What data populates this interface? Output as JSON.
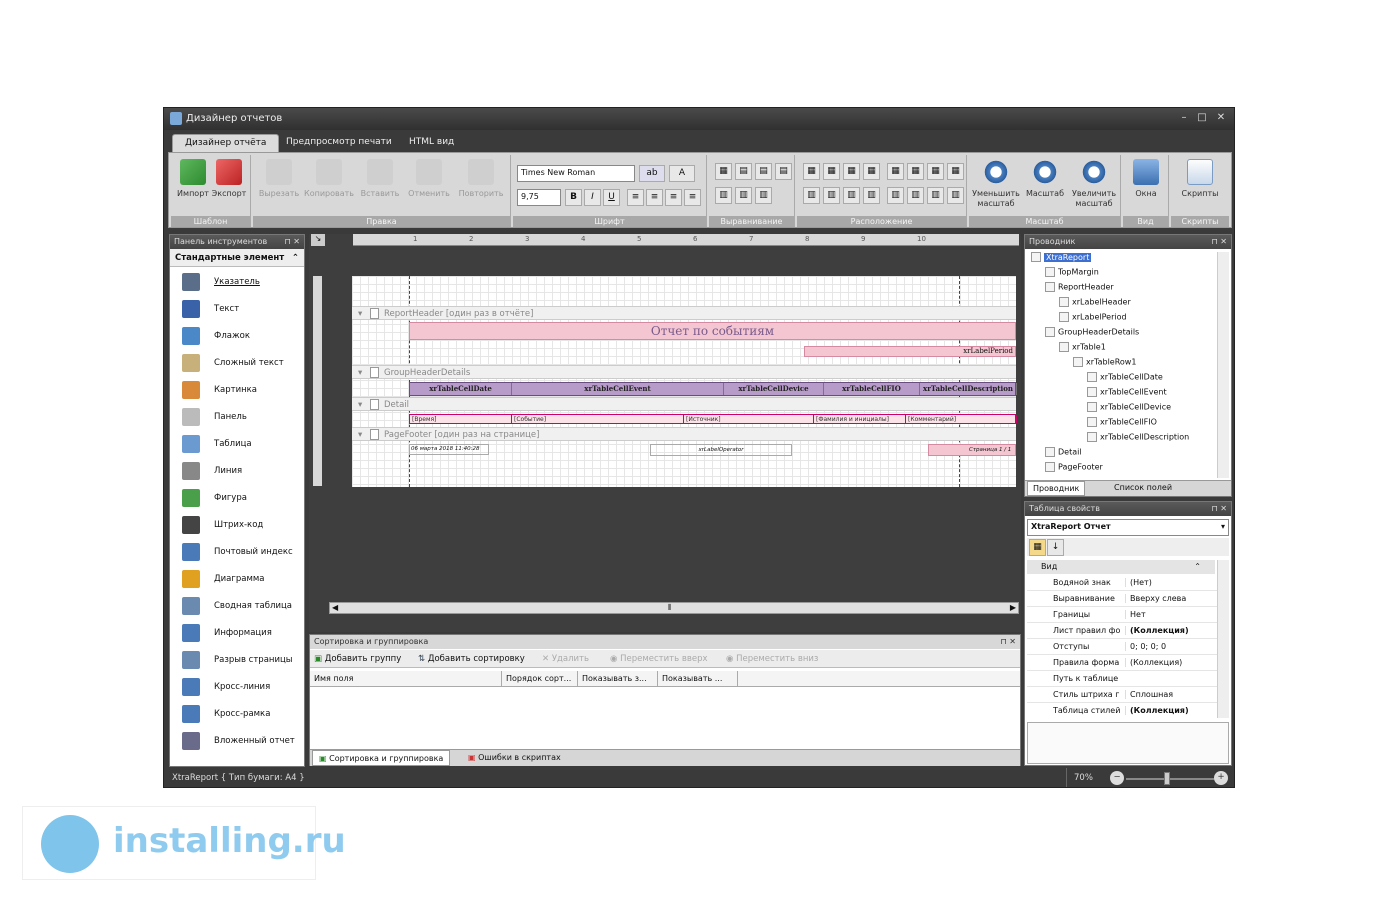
{
  "window": {
    "title": "Дизайнер отчетов",
    "min": "–",
    "max": "□",
    "close": "✕"
  },
  "tabs": [
    {
      "label": "Дизайнер отчёта"
    },
    {
      "label": "Предпросмотр печати"
    },
    {
      "label": "HTML вид"
    }
  ],
  "ribbon": {
    "groups": {
      "template": "Шаблон",
      "edit": "Правка",
      "font": "Шрифт",
      "align": "Выравнивание",
      "layout": "Расположение",
      "zoom": "Масштаб",
      "view": "Вид",
      "scripts": "Скрипты"
    },
    "buttons": {
      "import": "Импорт",
      "export": "Экспорт",
      "cut": "Вырезать",
      "copy": "Копировать",
      "paste": "Вставить",
      "undo": "Отменить",
      "redo": "Повторить",
      "zoom_out": "Уменьшить масштаб",
      "zoom": "Масштаб",
      "zoom_in": "Увеличить масштаб",
      "windows": "Окна",
      "scripts": "Скрипты"
    },
    "font_name": "Times New Roman",
    "font_size": "9,75"
  },
  "toolbox": {
    "title": "Панель инструментов",
    "section": "Стандартные элемент",
    "items": [
      {
        "label": "Указатель",
        "icon": "pointer-icon"
      },
      {
        "label": "Текст",
        "icon": "text-icon"
      },
      {
        "label": "Флажок",
        "icon": "checkbox-icon"
      },
      {
        "label": "Сложный текст",
        "icon": "richtext-icon"
      },
      {
        "label": "Картинка",
        "icon": "picture-icon"
      },
      {
        "label": "Панель",
        "icon": "panel-icon"
      },
      {
        "label": "Таблица",
        "icon": "table-icon"
      },
      {
        "label": "Линия",
        "icon": "line-icon"
      },
      {
        "label": "Фигура",
        "icon": "shape-icon"
      },
      {
        "label": "Штрих-код",
        "icon": "barcode-icon"
      },
      {
        "label": "Почтовый индекс",
        "icon": "zipcode-icon"
      },
      {
        "label": "Диаграмма",
        "icon": "chart-icon"
      },
      {
        "label": "Сводная таблица",
        "icon": "pivot-icon"
      },
      {
        "label": "Информация",
        "icon": "info-icon"
      },
      {
        "label": "Разрыв страницы",
        "icon": "pagebreak-icon"
      },
      {
        "label": "Кросс-линия",
        "icon": "crossline-icon"
      },
      {
        "label": "Кросс-рамка",
        "icon": "crossbox-icon"
      },
      {
        "label": "Вложенный отчет",
        "icon": "subreport-icon"
      }
    ]
  },
  "designer": {
    "bands": {
      "report_header": "ReportHeader [один раз в отчёте]",
      "group_header": "GroupHeaderDetails",
      "detail": "Detail",
      "page_footer": "PageFooter [один раз на странице]"
    },
    "title_label": "Отчет по событиям",
    "period_label": "xrLabelPeriod",
    "header_cells": [
      "xrTableCellDate",
      "xrTableCellEvent",
      "xrTableCellDevice",
      "xrTableCellFIO",
      "xrTableCellDescription"
    ],
    "detail_cells": [
      "[Время]",
      "[Событие]",
      "[Источник]",
      "[Фамилия и инициалы]",
      "[Комментарий]"
    ],
    "footer_date": "06 марта 2018 11:40:28",
    "footer_center": "xrLabelOperator",
    "footer_page": "Страница 1 / 1",
    "ruler_labels": [
      "1",
      "2",
      "3",
      "4",
      "5",
      "6",
      "7",
      "8",
      "9",
      "10"
    ]
  },
  "sort_panel": {
    "title": "Сортировка и группировка",
    "toolbar": {
      "add_group": "Добавить группу",
      "add_sort": "Добавить сортировку",
      "delete": "Удалить",
      "move_up": "Переместить вверх",
      "move_down": "Переместить вниз"
    },
    "columns": [
      "Имя поля",
      "Порядок сорт...",
      "Показывать з...",
      "Показывать ..."
    ],
    "tabs": {
      "sort": "Сортировка и группировка",
      "errors": "Ошибки в скриптах"
    }
  },
  "explorer": {
    "title": "Проводник",
    "nodes": [
      {
        "label": "XtraReport",
        "level": 0
      },
      {
        "label": "TopMargin",
        "level": 1
      },
      {
        "label": "ReportHeader",
        "level": 1
      },
      {
        "label": "xrLabelHeader",
        "level": 2
      },
      {
        "label": "xrLabelPeriod",
        "level": 2
      },
      {
        "label": "GroupHeaderDetails",
        "level": 1
      },
      {
        "label": "xrTable1",
        "level": 2
      },
      {
        "label": "xrTableRow1",
        "level": 3
      },
      {
        "label": "xrTableCellDate",
        "level": 4
      },
      {
        "label": "xrTableCellEvent",
        "level": 4
      },
      {
        "label": "xrTableCellDevice",
        "level": 4
      },
      {
        "label": "xrTableCellFIO",
        "level": 4
      },
      {
        "label": "xrTableCellDescription",
        "level": 4
      },
      {
        "label": "Detail",
        "level": 1
      },
      {
        "label": "PageFooter",
        "level": 1
      }
    ],
    "tabs": {
      "explorer": "Проводник",
      "fields": "Список полей"
    }
  },
  "props": {
    "title": "Таблица свойств",
    "object": "XtraReport  Отчет",
    "category": "Вид",
    "rows": [
      {
        "k": "Водяной знак",
        "v": "(Нет)"
      },
      {
        "k": "Выравнивание",
        "v": "Вверху слева"
      },
      {
        "k": "Границы",
        "v": "Нет"
      },
      {
        "k": "Лист правил фо",
        "v": "(Коллекция)"
      },
      {
        "k": "Отступы",
        "v": "0; 0; 0; 0"
      },
      {
        "k": "Правила форма",
        "v": "(Коллекция)"
      },
      {
        "k": "Путь к таблице",
        "v": ""
      },
      {
        "k": "Стиль штриха г",
        "v": "Сплошная"
      },
      {
        "k": "Таблица стилей",
        "v": "(Коллекция)"
      }
    ]
  },
  "status": {
    "left": "XtraReport { Тип бумаги: A4 }",
    "zoom": "70%"
  },
  "watermark": {
    "text": "installing.ru"
  }
}
